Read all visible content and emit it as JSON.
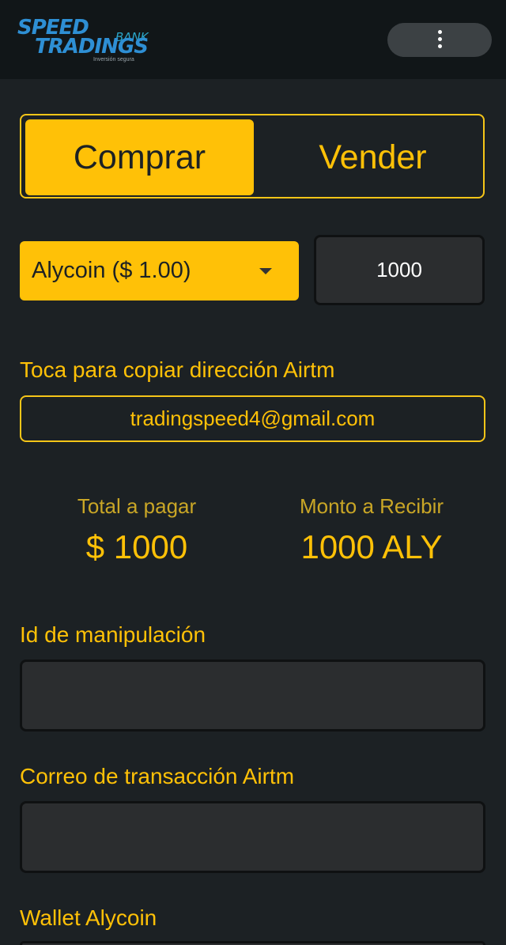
{
  "app": {
    "logo_line1": "SPEED",
    "logo_bank": "BANK",
    "logo_line2": "TRADINGS",
    "logo_tagline": "Inversión segura"
  },
  "toggle": {
    "buy_label": "Comprar",
    "sell_label": "Vender",
    "selected": "Comprar"
  },
  "order": {
    "coin_selected": "Alycoin ($ 1.00)",
    "amount_value": "1000"
  },
  "airtm": {
    "copy_label": "Toca para copiar dirección Airtm",
    "email": "tradingspeed4@gmail.com"
  },
  "summary": {
    "total_caption": "Total a pagar",
    "total_value": "$ 1000",
    "receive_caption": "Monto a Recibir",
    "receive_value": "1000 ALY"
  },
  "form": {
    "id_label": "Id de manipulación",
    "id_value": "",
    "email_label": "Correo de transacción Airtm",
    "email_value": "",
    "wallet_label": "Wallet Alycoin"
  },
  "colors": {
    "accent": "#ffc107",
    "background": "#1c2124",
    "appbar": "#111618",
    "input_bg": "#2b2d2f"
  },
  "icons": {
    "menu": "more-vert-icon",
    "dropdown": "caret-down-icon"
  }
}
